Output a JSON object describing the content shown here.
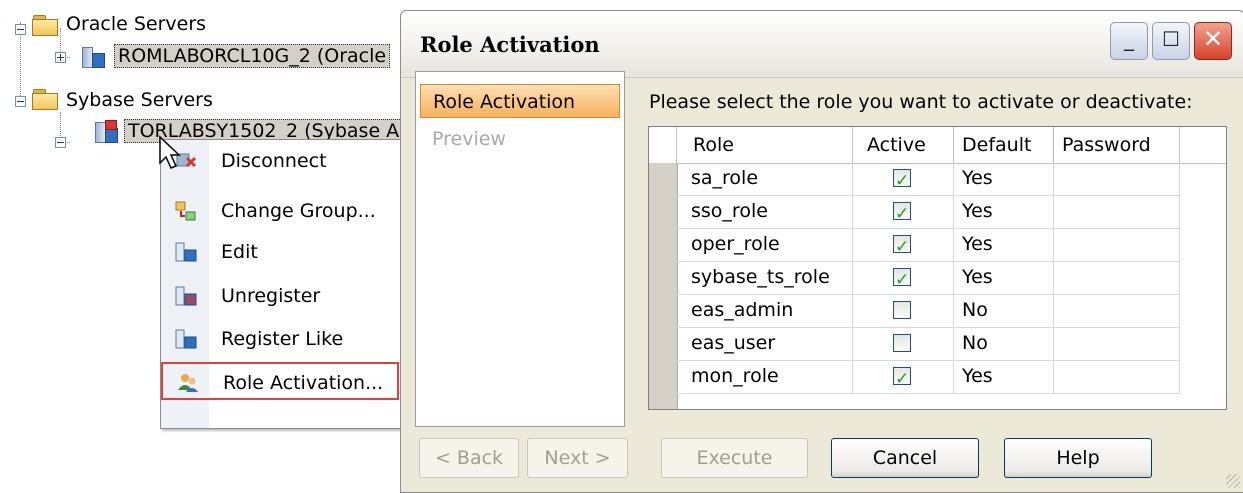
{
  "tree": {
    "groups": [
      {
        "label": "Oracle Servers",
        "servers": [
          {
            "label": "ROMLABORCL10G_2 (Oracle"
          }
        ]
      },
      {
        "label": "Sybase Servers",
        "servers": [
          {
            "label": "TORLABSY1502_2 (Sybase A"
          }
        ]
      }
    ]
  },
  "context_menu": {
    "items": [
      {
        "label": "Disconnect",
        "icon": "disconnect-icon"
      },
      {
        "label": "Change Group...",
        "icon": "change-group-icon"
      },
      {
        "label": "Edit",
        "icon": "edit-server-icon"
      },
      {
        "label": "Unregister",
        "icon": "unregister-icon"
      },
      {
        "label": "Register Like",
        "icon": "register-like-icon"
      },
      {
        "label": "Role Activation...",
        "icon": "users-icon"
      }
    ]
  },
  "dialog": {
    "title": "Role Activation",
    "steps": [
      {
        "label": "Role Activation",
        "state": "active"
      },
      {
        "label": "Preview",
        "state": "disabled"
      }
    ],
    "prompt": "Please select the role you want to activate or deactivate:",
    "columns": [
      "Role",
      "Active",
      "Default",
      "Password"
    ],
    "rows": [
      {
        "role": "sa_role",
        "active": true,
        "default": "Yes",
        "password": ""
      },
      {
        "role": "sso_role",
        "active": true,
        "default": "Yes",
        "password": ""
      },
      {
        "role": "oper_role",
        "active": true,
        "default": "Yes",
        "password": ""
      },
      {
        "role": "sybase_ts_role",
        "active": true,
        "default": "Yes",
        "password": ""
      },
      {
        "role": "eas_admin",
        "active": false,
        "default": "No",
        "password": ""
      },
      {
        "role": "eas_user",
        "active": false,
        "default": "No",
        "password": ""
      },
      {
        "role": "mon_role",
        "active": true,
        "default": "Yes",
        "password": ""
      }
    ],
    "buttons": {
      "back": {
        "label": "< Back",
        "enabled": false
      },
      "next": {
        "label": "Next >",
        "enabled": false
      },
      "execute": {
        "label": "Execute",
        "enabled": false
      },
      "cancel": {
        "label": "Cancel",
        "enabled": true
      },
      "help": {
        "label": "Help",
        "enabled": true
      }
    },
    "window_buttons": {
      "minimize": "minimize-icon",
      "maximize": "maximize-icon",
      "close": "close-icon"
    }
  },
  "colors": {
    "accent": "#f7b15d",
    "check": "#21a121",
    "highlight_border": "#d94343",
    "dialog_bg": "#ece9d8"
  }
}
